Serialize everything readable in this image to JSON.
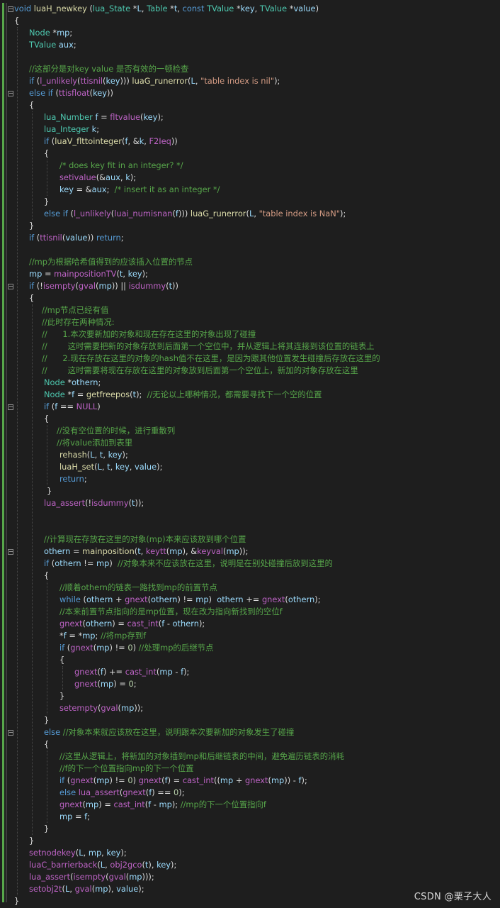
{
  "watermark": "CSDN @栗子大人",
  "lines": [
    [
      [
        "kw",
        "void "
      ],
      [
        "fn",
        "luaH_newkey"
      ],
      [
        "tx",
        " ("
      ],
      [
        "ty",
        "lua_State"
      ],
      [
        "tx",
        " *"
      ],
      [
        "vr",
        "L"
      ],
      [
        "tx",
        ", "
      ],
      [
        "ty",
        "Table"
      ],
      [
        "tx",
        " *"
      ],
      [
        "vr",
        "t"
      ],
      [
        "tx",
        ", "
      ],
      [
        "kw",
        "const "
      ],
      [
        "ty",
        "TValue"
      ],
      [
        "tx",
        " *"
      ],
      [
        "vr",
        "key"
      ],
      [
        "tx",
        ", "
      ],
      [
        "ty",
        "TValue"
      ],
      [
        "tx",
        " *"
      ],
      [
        "vr",
        "value"
      ],
      [
        "tx",
        ")"
      ]
    ],
    [
      [
        "tx",
        "{"
      ]
    ],
    [
      [
        "ty",
        "Node"
      ],
      [
        "tx",
        " *"
      ],
      [
        "vr",
        "mp"
      ],
      [
        "tx",
        ";"
      ]
    ],
    [
      [
        "ty",
        "TValue"
      ],
      [
        "tx",
        " "
      ],
      [
        "vr",
        "aux"
      ],
      [
        "tx",
        ";"
      ]
    ],
    [],
    [
      [
        "cm",
        "//这部分是对key value 是否有效的一顿检查"
      ]
    ],
    [
      [
        "kw",
        "if"
      ],
      [
        "tx",
        " ("
      ],
      [
        "pp",
        "l_unlikely"
      ],
      [
        "tx",
        "("
      ],
      [
        "pp",
        "ttisnil"
      ],
      [
        "tx",
        "("
      ],
      [
        "vr",
        "key"
      ],
      [
        "tx",
        ")))"
      ],
      [
        "tx",
        " "
      ],
      [
        "fn",
        "luaG_runerror"
      ],
      [
        "tx",
        "("
      ],
      [
        "vr",
        "L"
      ],
      [
        "tx",
        ", "
      ],
      [
        "st",
        "\"table index is nil\""
      ],
      [
        "tx",
        ");"
      ]
    ],
    [
      [
        "kw",
        "else if"
      ],
      [
        "tx",
        " ("
      ],
      [
        "pp",
        "ttisfloat"
      ],
      [
        "tx",
        "("
      ],
      [
        "vr",
        "key"
      ],
      [
        "tx",
        "))"
      ]
    ],
    [
      [
        "tx",
        "{"
      ]
    ],
    [
      [
        "ty",
        "lua_Number"
      ],
      [
        "tx",
        " "
      ],
      [
        "vr",
        "f"
      ],
      [
        "tx",
        " = "
      ],
      [
        "pp",
        "fltvalue"
      ],
      [
        "tx",
        "("
      ],
      [
        "vr",
        "key"
      ],
      [
        "tx",
        ");"
      ]
    ],
    [
      [
        "ty",
        "lua_Integer"
      ],
      [
        "tx",
        " "
      ],
      [
        "vr",
        "k"
      ],
      [
        "tx",
        ";"
      ]
    ],
    [
      [
        "kw",
        "if"
      ],
      [
        "tx",
        " ("
      ],
      [
        "fn",
        "luaV_flttointeger"
      ],
      [
        "tx",
        "("
      ],
      [
        "vr",
        "f"
      ],
      [
        "tx",
        ", &"
      ],
      [
        "vr",
        "k"
      ],
      [
        "tx",
        ", "
      ],
      [
        "pp",
        "F2Ieq"
      ],
      [
        "tx",
        "))"
      ]
    ],
    [
      [
        "tx",
        "{"
      ]
    ],
    [
      [
        "cm",
        "/* does key fit in an integer? */"
      ]
    ],
    [
      [
        "pp",
        "setivalue"
      ],
      [
        "tx",
        "(&"
      ],
      [
        "vr",
        "aux"
      ],
      [
        "tx",
        ", "
      ],
      [
        "vr",
        "k"
      ],
      [
        "tx",
        ");"
      ]
    ],
    [
      [
        "vr",
        "key"
      ],
      [
        "tx",
        " = &"
      ],
      [
        "vr",
        "aux"
      ],
      [
        "tx",
        ";  "
      ],
      [
        "cm",
        "/* insert it as an integer */"
      ]
    ],
    [
      [
        "tx",
        "}"
      ]
    ],
    [
      [
        "kw",
        "else if"
      ],
      [
        "tx",
        " ("
      ],
      [
        "pp",
        "l_unlikely"
      ],
      [
        "tx",
        "("
      ],
      [
        "pp",
        "luai_numisnan"
      ],
      [
        "tx",
        "("
      ],
      [
        "vr",
        "f"
      ],
      [
        "tx",
        ")))"
      ],
      [
        "tx",
        " "
      ],
      [
        "fn",
        "luaG_runerror"
      ],
      [
        "tx",
        "("
      ],
      [
        "vr",
        "L"
      ],
      [
        "tx",
        ", "
      ],
      [
        "st",
        "\"table index is NaN\""
      ],
      [
        "tx",
        ");"
      ]
    ],
    [
      [
        "tx",
        "}"
      ]
    ],
    [
      [
        "kw",
        "if"
      ],
      [
        "tx",
        " ("
      ],
      [
        "pp",
        "ttisnil"
      ],
      [
        "tx",
        "("
      ],
      [
        "vr",
        "value"
      ],
      [
        "tx",
        "))"
      ],
      [
        "kw",
        " return"
      ],
      [
        "tx",
        ";"
      ]
    ],
    [],
    [
      [
        "cm",
        "//mp为根据哈希值得到的应该插入位置的节点"
      ]
    ],
    [
      [
        "vr",
        "mp"
      ],
      [
        "tx",
        " = "
      ],
      [
        "pp",
        "mainpositionTV"
      ],
      [
        "tx",
        "("
      ],
      [
        "vr",
        "t"
      ],
      [
        "tx",
        ", "
      ],
      [
        "vr",
        "key"
      ],
      [
        "tx",
        ");"
      ]
    ],
    [
      [
        "kw",
        "if"
      ],
      [
        "tx",
        " (!"
      ],
      [
        "pp",
        "isempty"
      ],
      [
        "tx",
        "("
      ],
      [
        "pp",
        "gval"
      ],
      [
        "tx",
        "("
      ],
      [
        "vr",
        "mp"
      ],
      [
        "tx",
        "))"
      ],
      [
        "tx",
        " || "
      ],
      [
        "pp",
        "isdummy"
      ],
      [
        "tx",
        "("
      ],
      [
        "vr",
        "t"
      ],
      [
        "tx",
        "))"
      ]
    ],
    [
      [
        "tx",
        "{"
      ]
    ],
    [
      [
        "cm",
        "//mp节点已经有值"
      ]
    ],
    [
      [
        "cm",
        "//此时存在两种情况:"
      ]
    ],
    [
      [
        "cm",
        "//      1.本次要新加的对象和现在存在这里的对象出现了碰撞"
      ]
    ],
    [
      [
        "cm",
        "//        这时需要把新的对象存放到后面第一个空位中，并从逻辑上将其连接到该位置的链表上"
      ]
    ],
    [
      [
        "cm",
        "//      2.现在存放在这里的对象的hash值不在这里，是因为跟其他位置发生碰撞后存放在这里的"
      ]
    ],
    [
      [
        "cm",
        "//        这时需要将现在存放在这里的对象放到后面第一个空位上，新加的对象存放在这里"
      ]
    ],
    [
      [
        "ty",
        "Node"
      ],
      [
        "tx",
        " *"
      ],
      [
        "vr",
        "othern"
      ],
      [
        "tx",
        ";"
      ]
    ],
    [
      [
        "ty",
        "Node"
      ],
      [
        "tx",
        " *"
      ],
      [
        "vr",
        "f"
      ],
      [
        "tx",
        " = "
      ],
      [
        "fn",
        "getfreepos"
      ],
      [
        "tx",
        "("
      ],
      [
        "vr",
        "t"
      ],
      [
        "tx",
        ");  "
      ],
      [
        "cm",
        "//无论以上哪种情况，都需要寻找下一个空的位置"
      ]
    ],
    [
      [
        "kw",
        "if"
      ],
      [
        "tx",
        " ("
      ],
      [
        "vr",
        "f"
      ],
      [
        "tx",
        " == "
      ],
      [
        "pp",
        "NULL"
      ],
      [
        "tx",
        ")"
      ]
    ],
    [
      [
        "tx",
        "{"
      ]
    ],
    [
      [
        "cm",
        "//没有空位置的时候，进行重散列"
      ]
    ],
    [
      [
        "cm",
        "//将value添加到表里"
      ]
    ],
    [
      [
        "fn",
        "rehash"
      ],
      [
        "tx",
        "("
      ],
      [
        "vr",
        "L"
      ],
      [
        "tx",
        ", "
      ],
      [
        "vr",
        "t"
      ],
      [
        "tx",
        ", "
      ],
      [
        "vr",
        "key"
      ],
      [
        "tx",
        ");"
      ]
    ],
    [
      [
        "fn",
        "luaH_set"
      ],
      [
        "tx",
        "("
      ],
      [
        "vr",
        "L"
      ],
      [
        "tx",
        ", "
      ],
      [
        "vr",
        "t"
      ],
      [
        "tx",
        ", "
      ],
      [
        "vr",
        "key"
      ],
      [
        "tx",
        ", "
      ],
      [
        "vr",
        "value"
      ],
      [
        "tx",
        ");"
      ]
    ],
    [
      [
        "kw",
        "return"
      ],
      [
        "tx",
        ";"
      ]
    ],
    [
      [
        "tx",
        "}"
      ]
    ],
    [
      [
        "pp",
        "lua_assert"
      ],
      [
        "tx",
        "(!"
      ],
      [
        "pp",
        "isdummy"
      ],
      [
        "tx",
        "("
      ],
      [
        "vr",
        "t"
      ],
      [
        "tx",
        "));"
      ]
    ],
    [],
    [],
    [
      [
        "cm",
        "//计算现在存放在这里的对象(mp)本来应该放到哪个位置"
      ]
    ],
    [
      [
        "vr",
        "othern"
      ],
      [
        "tx",
        " = "
      ],
      [
        "fn",
        "mainposition"
      ],
      [
        "tx",
        "("
      ],
      [
        "vr",
        "t"
      ],
      [
        "tx",
        ", "
      ],
      [
        "pp",
        "keytt"
      ],
      [
        "tx",
        "("
      ],
      [
        "vr",
        "mp"
      ],
      [
        "tx",
        "), &"
      ],
      [
        "pp",
        "keyval"
      ],
      [
        "tx",
        "("
      ],
      [
        "vr",
        "mp"
      ],
      [
        "tx",
        "));"
      ]
    ],
    [
      [
        "kw",
        "if"
      ],
      [
        "tx",
        " ("
      ],
      [
        "vr",
        "othern"
      ],
      [
        "tx",
        " != "
      ],
      [
        "vr",
        "mp"
      ],
      [
        "tx",
        ")  "
      ],
      [
        "cm",
        "//对象本来不应该放在这里，说明是在别处碰撞后放到这里的"
      ]
    ],
    [
      [
        "tx",
        "{"
      ]
    ],
    [
      [
        "cm",
        "//顺着othern的链表一路找到mp的前置节点"
      ]
    ],
    [
      [
        "kw",
        "while"
      ],
      [
        "tx",
        " ("
      ],
      [
        "vr",
        "othern"
      ],
      [
        "tx",
        " + "
      ],
      [
        "pp",
        "gnext"
      ],
      [
        "tx",
        "("
      ],
      [
        "vr",
        "othern"
      ],
      [
        "tx",
        ") != "
      ],
      [
        "vr",
        "mp"
      ],
      [
        "tx",
        ")  "
      ],
      [
        "vr",
        "othern"
      ],
      [
        "tx",
        " += "
      ],
      [
        "pp",
        "gnext"
      ],
      [
        "tx",
        "("
      ],
      [
        "vr",
        "othern"
      ],
      [
        "tx",
        ");"
      ]
    ],
    [
      [
        "cm",
        "//本来前置节点指向的是mp位置，现在改为指向新找到的空位f"
      ]
    ],
    [
      [
        "pp",
        "gnext"
      ],
      [
        "tx",
        "("
      ],
      [
        "vr",
        "othern"
      ],
      [
        "tx",
        ") = "
      ],
      [
        "pp",
        "cast_int"
      ],
      [
        "tx",
        "("
      ],
      [
        "vr",
        "f"
      ],
      [
        "tx",
        " - "
      ],
      [
        "vr",
        "othern"
      ],
      [
        "tx",
        ");"
      ]
    ],
    [
      [
        "tx",
        "*"
      ],
      [
        "vr",
        "f"
      ],
      [
        "tx",
        " = *"
      ],
      [
        "vr",
        "mp"
      ],
      [
        "tx",
        "; "
      ],
      [
        "cm",
        "//将mp存到f"
      ]
    ],
    [
      [
        "kw",
        "if"
      ],
      [
        "tx",
        " ("
      ],
      [
        "pp",
        "gnext"
      ],
      [
        "tx",
        "("
      ],
      [
        "vr",
        "mp"
      ],
      [
        "tx",
        ") != "
      ],
      [
        "num",
        "0"
      ],
      [
        "tx",
        ") "
      ],
      [
        "cm",
        "//处理mp的后继节点"
      ]
    ],
    [
      [
        "tx",
        "{"
      ]
    ],
    [
      [
        "pp",
        "gnext"
      ],
      [
        "tx",
        "("
      ],
      [
        "vr",
        "f"
      ],
      [
        "tx",
        ") += "
      ],
      [
        "pp",
        "cast_int"
      ],
      [
        "tx",
        "("
      ],
      [
        "vr",
        "mp"
      ],
      [
        "tx",
        " - "
      ],
      [
        "vr",
        "f"
      ],
      [
        "tx",
        ");"
      ]
    ],
    [
      [
        "pp",
        "gnext"
      ],
      [
        "tx",
        "("
      ],
      [
        "vr",
        "mp"
      ],
      [
        "tx",
        ") = "
      ],
      [
        "num",
        "0"
      ],
      [
        "tx",
        ";"
      ]
    ],
    [
      [
        "tx",
        "}"
      ]
    ],
    [
      [
        "pp",
        "setempty"
      ],
      [
        "tx",
        "("
      ],
      [
        "pp",
        "gval"
      ],
      [
        "tx",
        "("
      ],
      [
        "vr",
        "mp"
      ],
      [
        "tx",
        "));"
      ]
    ],
    [
      [
        "tx",
        "}"
      ]
    ],
    [
      [
        "kw",
        "else"
      ],
      [
        "tx",
        " "
      ],
      [
        "cm",
        "//对象本来就应该放在这里，说明跟本次要新加的对象发生了碰撞"
      ]
    ],
    [
      [
        "tx",
        "{"
      ]
    ],
    [
      [
        "cm",
        "//这里从逻辑上，将新加的对象插到mp和后继链表的中间，避免遍历链表的消耗"
      ]
    ],
    [
      [
        "cm",
        "//f的下一个位置指向mp的下一个位置"
      ]
    ],
    [
      [
        "kw",
        "if"
      ],
      [
        "tx",
        " ("
      ],
      [
        "pp",
        "gnext"
      ],
      [
        "tx",
        "("
      ],
      [
        "vr",
        "mp"
      ],
      [
        "tx",
        ") != "
      ],
      [
        "num",
        "0"
      ],
      [
        "tx",
        ") "
      ],
      [
        "pp",
        "gnext"
      ],
      [
        "tx",
        "("
      ],
      [
        "vr",
        "f"
      ],
      [
        "tx",
        ") = "
      ],
      [
        "pp",
        "cast_int"
      ],
      [
        "tx",
        "(("
      ],
      [
        "vr",
        "mp"
      ],
      [
        "tx",
        " + "
      ],
      [
        "pp",
        "gnext"
      ],
      [
        "tx",
        "("
      ],
      [
        "vr",
        "mp"
      ],
      [
        "tx",
        ")) - "
      ],
      [
        "vr",
        "f"
      ],
      [
        "tx",
        ");"
      ]
    ],
    [
      [
        "kw",
        "else"
      ],
      [
        "tx",
        " "
      ],
      [
        "pp",
        "lua_assert"
      ],
      [
        "tx",
        "("
      ],
      [
        "pp",
        "gnext"
      ],
      [
        "tx",
        "("
      ],
      [
        "vr",
        "f"
      ],
      [
        "tx",
        ") == "
      ],
      [
        "num",
        "0"
      ],
      [
        "tx",
        ");"
      ]
    ],
    [
      [
        "pp",
        "gnext"
      ],
      [
        "tx",
        "("
      ],
      [
        "vr",
        "mp"
      ],
      [
        "tx",
        ") = "
      ],
      [
        "pp",
        "cast_int"
      ],
      [
        "tx",
        "("
      ],
      [
        "vr",
        "f"
      ],
      [
        "tx",
        " - "
      ],
      [
        "vr",
        "mp"
      ],
      [
        "tx",
        "); "
      ],
      [
        "cm",
        "//mp的下一个位置指向f"
      ]
    ],
    [
      [
        "vr",
        "mp"
      ],
      [
        "tx",
        " = "
      ],
      [
        "vr",
        "f"
      ],
      [
        "tx",
        ";"
      ]
    ],
    [
      [
        "tx",
        "}"
      ]
    ],
    [
      [
        "tx",
        "}"
      ]
    ],
    [
      [
        "pp",
        "setnodekey"
      ],
      [
        "tx",
        "("
      ],
      [
        "vr",
        "L"
      ],
      [
        "tx",
        ", "
      ],
      [
        "vr",
        "mp"
      ],
      [
        "tx",
        ", "
      ],
      [
        "vr",
        "key"
      ],
      [
        "tx",
        ");"
      ]
    ],
    [
      [
        "pp",
        "luaC_barrierback"
      ],
      [
        "tx",
        "("
      ],
      [
        "vr",
        "L"
      ],
      [
        "tx",
        ", "
      ],
      [
        "pp",
        "obj2gco"
      ],
      [
        "tx",
        "("
      ],
      [
        "vr",
        "t"
      ],
      [
        "tx",
        "), "
      ],
      [
        "vr",
        "key"
      ],
      [
        "tx",
        ");"
      ]
    ],
    [
      [
        "pp",
        "lua_assert"
      ],
      [
        "tx",
        "("
      ],
      [
        "pp",
        "isempty"
      ],
      [
        "tx",
        "("
      ],
      [
        "pp",
        "gval"
      ],
      [
        "tx",
        "("
      ],
      [
        "vr",
        "mp"
      ],
      [
        "tx",
        ")));"
      ]
    ],
    [
      [
        "pp",
        "setobj2t"
      ],
      [
        "tx",
        "("
      ],
      [
        "vr",
        "L"
      ],
      [
        "tx",
        ", "
      ],
      [
        "pp",
        "gval"
      ],
      [
        "tx",
        "("
      ],
      [
        "vr",
        "mp"
      ],
      [
        "tx",
        "), "
      ],
      [
        "vr",
        "value"
      ],
      [
        "tx",
        ");"
      ]
    ],
    [
      [
        "tx",
        "}"
      ]
    ]
  ]
}
